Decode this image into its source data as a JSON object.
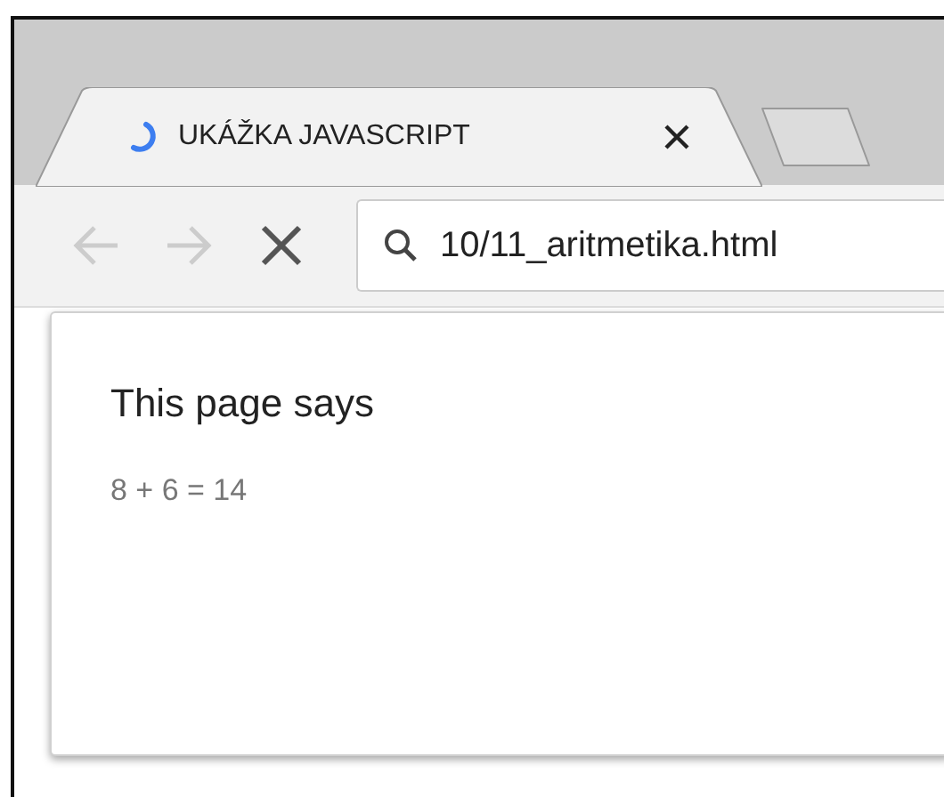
{
  "tab": {
    "title": "UKÁŽKA JAVASCRIPT",
    "loading": true
  },
  "toolbar": {
    "address": "10/11_aritmetika.html"
  },
  "dialog": {
    "title": "This page says",
    "message": "8 + 6 = 14"
  }
}
